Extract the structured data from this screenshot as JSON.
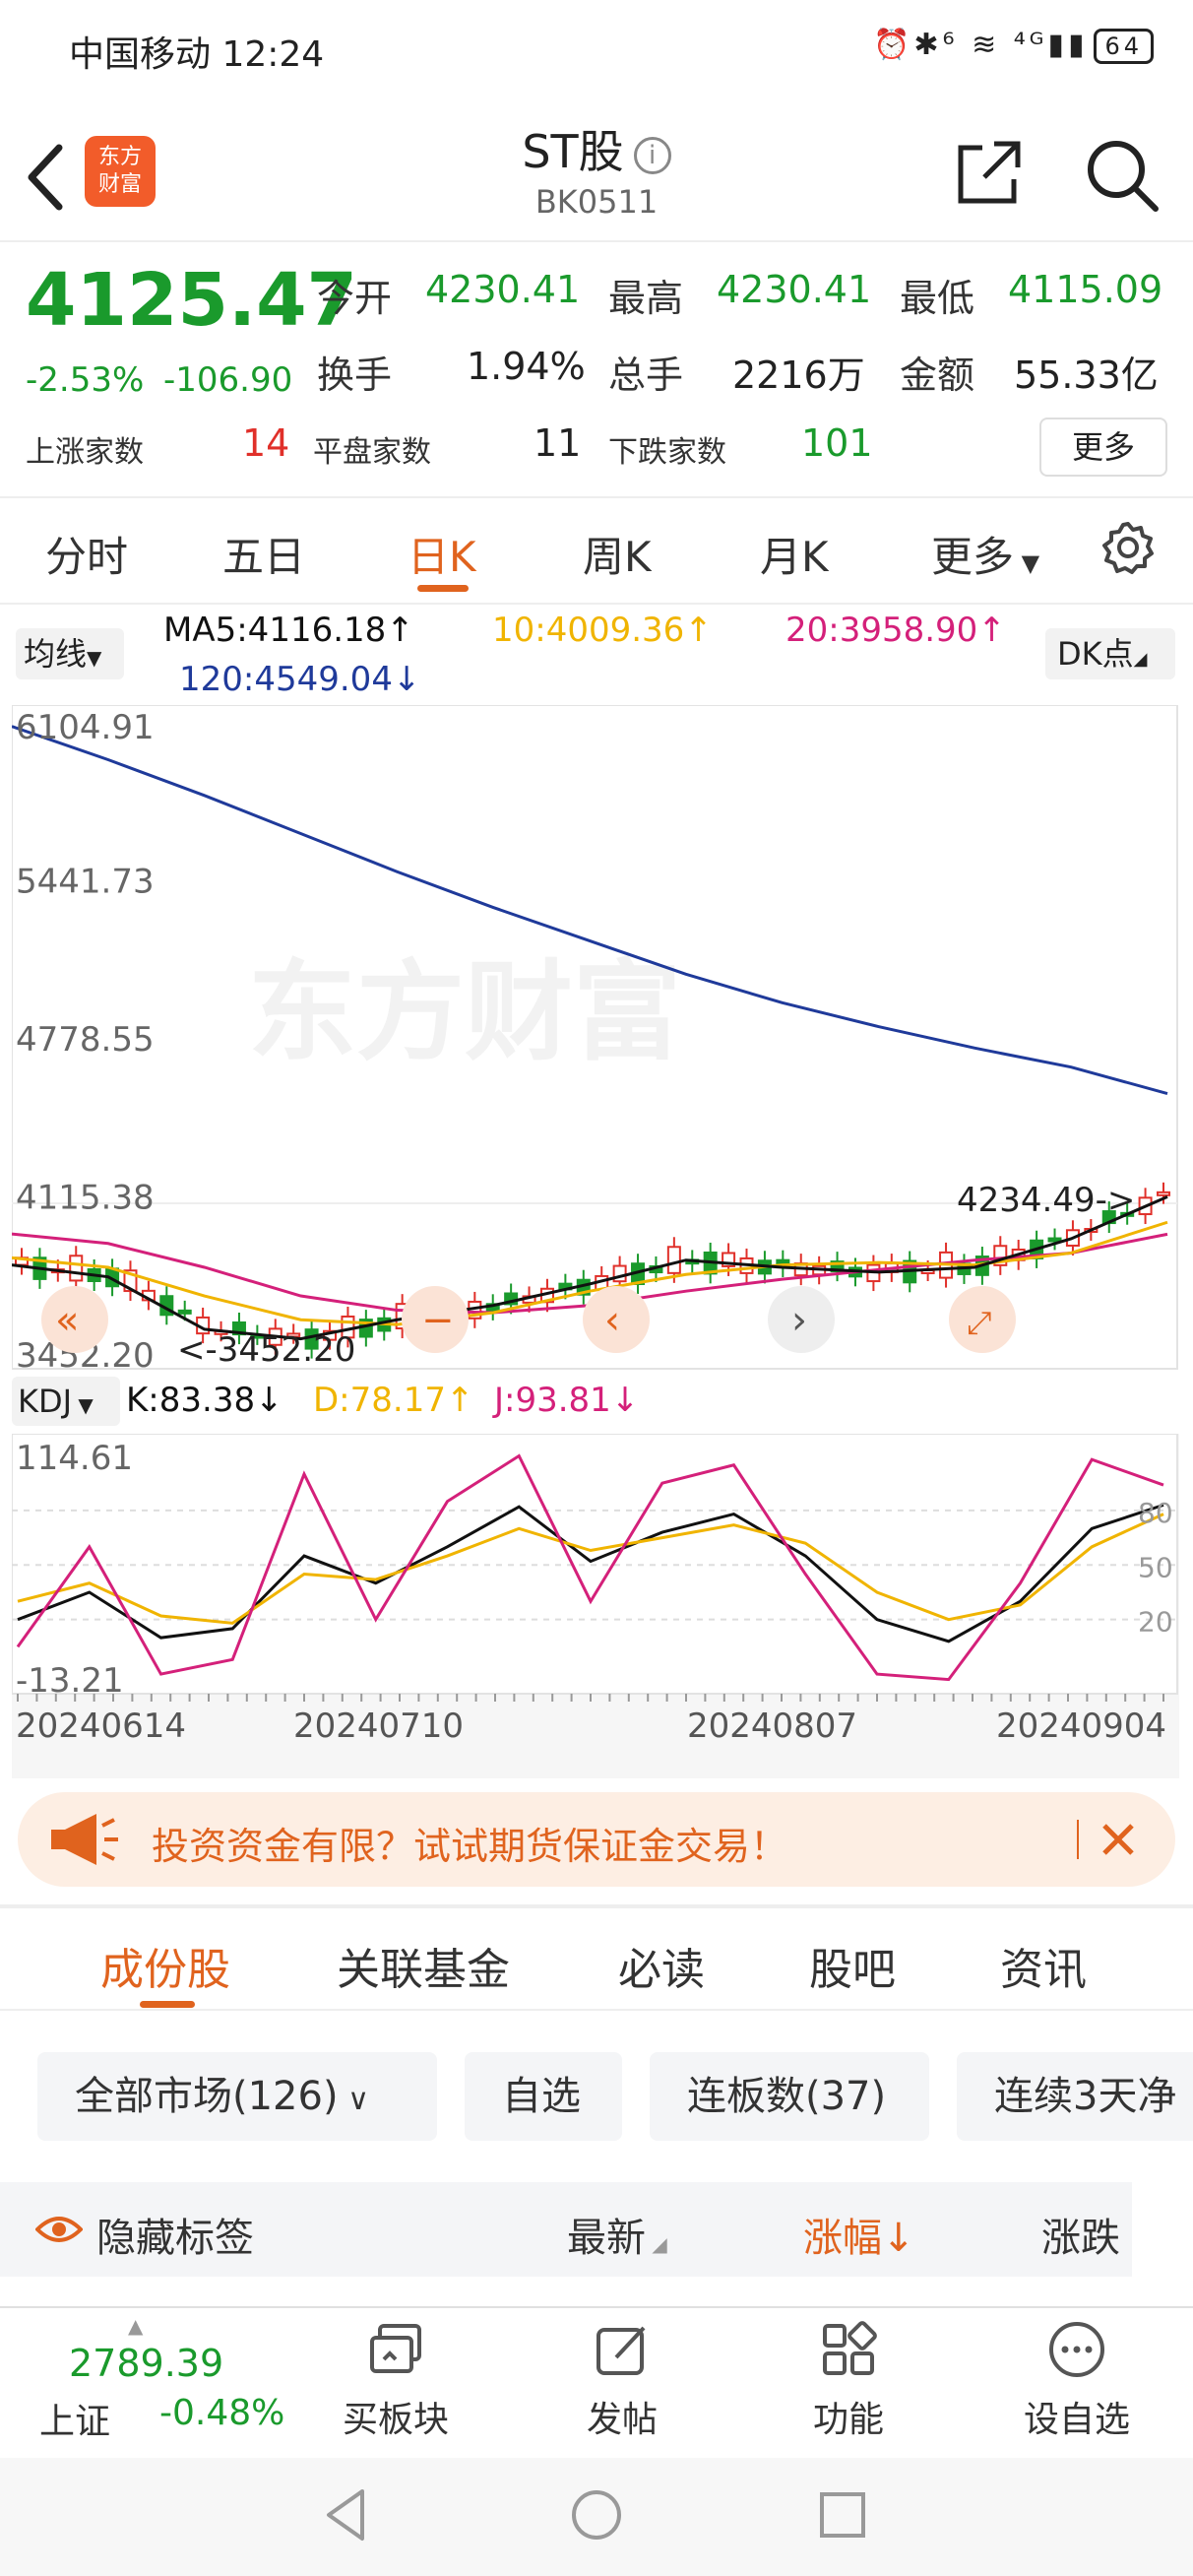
{
  "status_bar": {
    "carrier_time": "中国移动 12:24",
    "icons": "⏰✱⁶ ≋ ⁴ᴳ▮▮",
    "battery": "64"
  },
  "nav": {
    "title": "ST股",
    "code": "BK0511",
    "logo_line1": "东方",
    "logo_line2": "财富"
  },
  "quote": {
    "price": "4125.47",
    "change_pct": "-2.53%",
    "change": "-106.90",
    "open_label": "今开",
    "open": "4230.41",
    "high_label": "最高",
    "high": "4230.41",
    "low_label": "最低",
    "low": "4115.09",
    "turnover_label": "换手",
    "turnover": "1.94%",
    "volume_label": "总手",
    "volume": "2216万",
    "amount_label": "金额",
    "amount": "55.33亿",
    "up_label": "上涨家数",
    "up_count": "14",
    "flat_label": "平盘家数",
    "flat_count": "11",
    "down_label": "下跌家数",
    "down_count": "101",
    "more_button": "更多"
  },
  "tabs": [
    "分时",
    "五日",
    "日K",
    "周K",
    "月K",
    "更多"
  ],
  "ma": {
    "button": "均线",
    "ma5": "MA5:4116.18↑",
    "ma10": "10:4009.36↑",
    "ma20": "20:3958.90↑",
    "ma120": "120:4549.04↓",
    "dk_button": "DK点",
    "colors": {
      "ma5": "#111111",
      "ma10": "#f0b400",
      "ma20": "#d4207a",
      "ma120": "#1f3a9a"
    }
  },
  "kdj": {
    "button": "KDJ",
    "k": "K:83.38↓",
    "d": "D:78.17↑",
    "j": "J:93.81↓"
  },
  "chart_data": [
    {
      "type": "line",
      "title": "",
      "y_ticks": [
        "6104.91",
        "5441.73",
        "4778.55",
        "4115.38",
        "3452.20"
      ],
      "ylim": [
        3452.2,
        6104.91
      ],
      "annotations": [
        "4234.49->",
        "<-3452.20"
      ],
      "x_labels": [
        "20240614",
        "20240710",
        "20240807",
        "20240904"
      ],
      "series": [
        {
          "name": "MA120",
          "values": [
            6090,
            5950,
            5800,
            5640,
            5480,
            5330,
            5190,
            5050,
            4930,
            4830,
            4740,
            4660,
            4549
          ]
        },
        {
          "name": "MA20",
          "values": [
            3960,
            3920,
            3820,
            3700,
            3640,
            3630,
            3660,
            3720,
            3770,
            3810,
            3850,
            3880,
            3959
          ]
        },
        {
          "name": "MA10",
          "values": [
            3860,
            3820,
            3700,
            3600,
            3580,
            3630,
            3720,
            3790,
            3830,
            3840,
            3830,
            3880,
            4009
          ]
        },
        {
          "name": "MA5",
          "values": [
            3830,
            3780,
            3560,
            3520,
            3600,
            3660,
            3750,
            3850,
            3820,
            3800,
            3820,
            3940,
            4116
          ]
        }
      ]
    },
    {
      "type": "line",
      "title": "",
      "y_ticks": [
        "114.61",
        "80",
        "50",
        "20",
        "-13.21"
      ],
      "ylim": [
        -13.21,
        114.61
      ],
      "series": [
        {
          "name": "K",
          "values": [
            20,
            35,
            10,
            15,
            55,
            40,
            60,
            82,
            52,
            68,
            78,
            55,
            20,
            8,
            30,
            70,
            83
          ]
        },
        {
          "name": "D",
          "values": [
            30,
            40,
            22,
            18,
            45,
            42,
            55,
            70,
            58,
            65,
            72,
            62,
            35,
            20,
            28,
            60,
            78
          ]
        },
        {
          "name": "J",
          "values": [
            5,
            60,
            -10,
            -2,
            100,
            20,
            85,
            110,
            30,
            95,
            105,
            45,
            -10,
            -13,
            40,
            108,
            94
          ]
        }
      ]
    }
  ],
  "ad": {
    "text": "投资资金有限？试试期货保证金交易！"
  },
  "sub_tabs": [
    "成份股",
    "关联基金",
    "必读",
    "股吧",
    "资讯"
  ],
  "filters": [
    "全部市场(126)",
    "自选",
    "连板数(37)",
    "连续3天净"
  ],
  "list_header": {
    "hide_tags": "隐藏标签",
    "latest": "最新",
    "change_pct": "涨幅",
    "change": "涨跌"
  },
  "bottom_bar": {
    "index_value": "2789.39",
    "index_name": "上证",
    "index_change": "-0.48%",
    "items": [
      "买板块",
      "发帖",
      "功能",
      "设自选"
    ]
  }
}
